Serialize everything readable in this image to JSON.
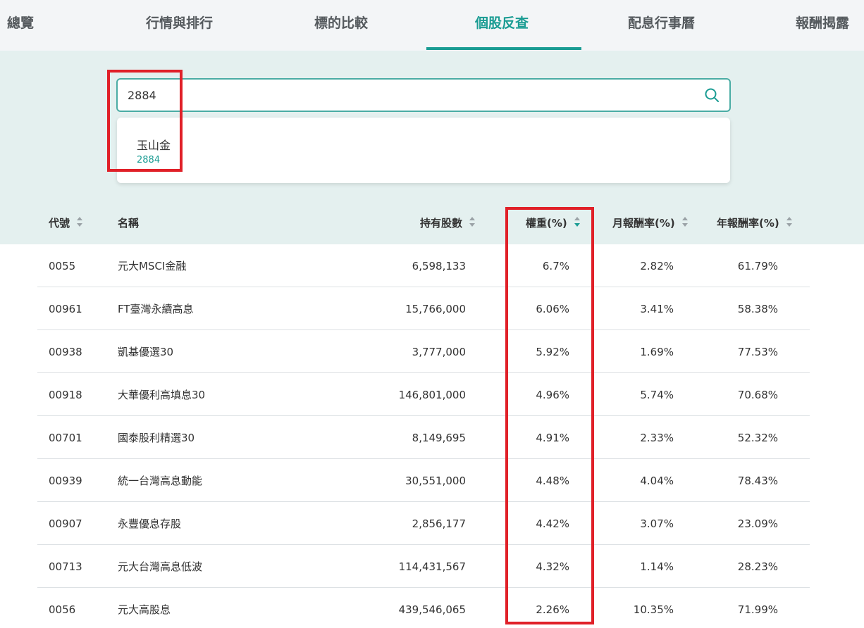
{
  "tabs": [
    {
      "label": "總覽",
      "active": false
    },
    {
      "label": "行情與排行",
      "active": false
    },
    {
      "label": "標的比較",
      "active": false
    },
    {
      "label": "個股反查",
      "active": true
    },
    {
      "label": "配息行事曆",
      "active": false
    },
    {
      "label": "報酬揭露",
      "active": false
    }
  ],
  "search": {
    "value": "2884",
    "icon": "search-icon",
    "suggestions": [
      {
        "name": "玉山金",
        "code": "2884"
      }
    ]
  },
  "table": {
    "headers": {
      "code": "代號",
      "name": "名稱",
      "shares": "持有股數",
      "weight": "權重(%)",
      "month_return": "月報酬率(%)",
      "year_return": "年報酬率(%)"
    },
    "sorted_by": "weight",
    "sort_direction": "desc",
    "rows": [
      {
        "code": "0055",
        "name": "元大MSCI金融",
        "shares": "6,598,133",
        "weight": "6.7%",
        "month_return": "2.82%",
        "year_return": "61.79%"
      },
      {
        "code": "00961",
        "name": "FT臺灣永續高息",
        "shares": "15,766,000",
        "weight": "6.06%",
        "month_return": "3.41%",
        "year_return": "58.38%"
      },
      {
        "code": "00938",
        "name": "凱基優選30",
        "shares": "3,777,000",
        "weight": "5.92%",
        "month_return": "1.69%",
        "year_return": "77.53%"
      },
      {
        "code": "00918",
        "name": "大華優利高填息30",
        "shares": "146,801,000",
        "weight": "4.96%",
        "month_return": "5.74%",
        "year_return": "70.68%"
      },
      {
        "code": "00701",
        "name": "國泰股利精選30",
        "shares": "8,149,695",
        "weight": "4.91%",
        "month_return": "2.33%",
        "year_return": "52.32%"
      },
      {
        "code": "00939",
        "name": "統一台灣高息動能",
        "shares": "30,551,000",
        "weight": "4.48%",
        "month_return": "4.04%",
        "year_return": "78.43%"
      },
      {
        "code": "00907",
        "name": "永豐優息存股",
        "shares": "2,856,177",
        "weight": "4.42%",
        "month_return": "3.07%",
        "year_return": "23.09%"
      },
      {
        "code": "00713",
        "name": "元大台灣高息低波",
        "shares": "114,431,567",
        "weight": "4.32%",
        "month_return": "1.14%",
        "year_return": "28.23%"
      },
      {
        "code": "0056",
        "name": "元大高股息",
        "shares": "439,546,065",
        "weight": "2.26%",
        "month_return": "10.35%",
        "year_return": "71.99%"
      }
    ]
  },
  "colors": {
    "accent": "#1a9c93",
    "highlight": "#e02028",
    "band": "#e4f0ef"
  }
}
